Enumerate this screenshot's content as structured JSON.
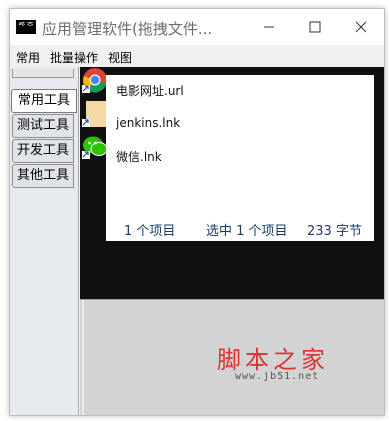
{
  "window": {
    "app_icon_text": "ᄚᄒ",
    "title": "应用管理软件(拖拽文件..."
  },
  "menu": [
    "常用",
    "批量操作",
    "视图"
  ],
  "tabs": [
    {
      "label": "常用工具",
      "active": true
    },
    {
      "label": "测试工具",
      "active": false
    },
    {
      "label": "开发工具",
      "active": false
    },
    {
      "label": "其他工具",
      "active": false
    }
  ],
  "files": [
    {
      "name": "电影网址.url",
      "icon": "chrome-icon"
    },
    {
      "name": "jenkins.lnk",
      "icon": "jenkins-icon"
    },
    {
      "name": "微信.lnk",
      "icon": "wechat-icon"
    }
  ],
  "status": {
    "count": "1 个项目",
    "selected": "选中 1 个项目",
    "size": "233 字节"
  },
  "watermark": {
    "main": "脚本之家",
    "sub": "www.jb51.net"
  },
  "colors": {
    "status_text": "#1a3a6e",
    "watermark": "#dd3333"
  }
}
